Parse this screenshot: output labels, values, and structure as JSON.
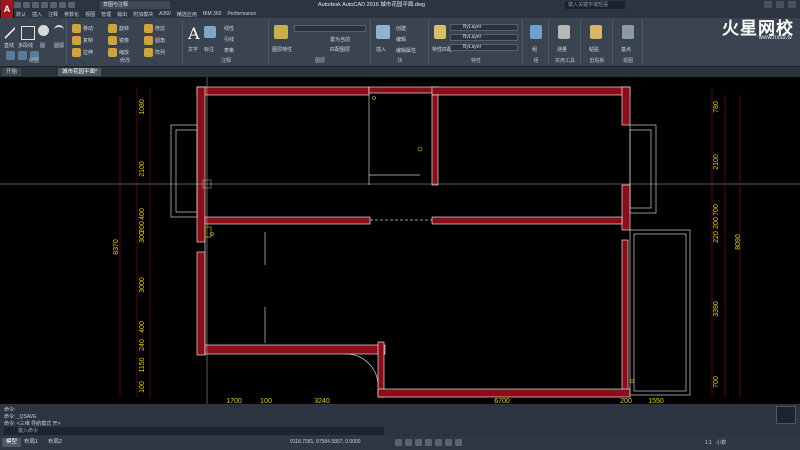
{
  "titlebar": {
    "workspace": "草图与注释",
    "title": "Autodesk AutoCAD 2016    城市花园平面.dwg",
    "search_placeholder": "键入关键字或短语"
  },
  "menubar": [
    "默认",
    "插入",
    "注释",
    "参数化",
    "视图",
    "管理",
    "输出",
    "附加模块",
    "A360",
    "精选应用",
    "BIM 360",
    "Performance"
  ],
  "ribbon": {
    "draw": {
      "line": "直线",
      "polyline": "多段线",
      "circle": "圆",
      "arc": "圆弧",
      "group_label": "绘图"
    },
    "modify": {
      "move": "移动",
      "rotate": "旋转",
      "trim": "修剪",
      "copy": "复制",
      "mirror": "镜像",
      "fillet": "圆角",
      "stretch": "拉伸",
      "scale": "缩放",
      "array": "阵列",
      "group_label": "修改"
    },
    "annotation": {
      "text": "文字",
      "dimension": "标注",
      "linear": "线性",
      "leader": "引线",
      "table": "表格",
      "group_label": "注释"
    },
    "layers": {
      "layer_props": "图层特性",
      "make_current": "置为当前",
      "match_layer": "匹配图层",
      "group_label": "图层"
    },
    "block": {
      "insert": "插入",
      "create": "创建",
      "edit": "编辑",
      "edit_attr": "编辑属性",
      "group_label": "块"
    },
    "properties": {
      "match": "特性匹配",
      "bylayer1": "ByLayer",
      "bylayer2": "ByLayer",
      "bylayer3": "ByLayer",
      "group_label": "特性"
    },
    "groups": {
      "group": "组",
      "group_label": "组"
    },
    "utilities": {
      "measure": "测量",
      "group_label": "实用工具"
    },
    "clipboard": {
      "paste": "粘贴",
      "group_label": "剪贴板"
    },
    "view": {
      "base": "基点",
      "group_label": "视图"
    }
  },
  "watermark": {
    "brand": "火星网校",
    "url": "www.hxsd.tv"
  },
  "doc_tabs": [
    "开始",
    "城市花园平面*"
  ],
  "drawing": {
    "left_dims": [
      "1080",
      "2100",
      "400",
      "200",
      "300",
      "3000",
      "400",
      "240",
      "1150",
      "100"
    ],
    "left_total": "8370",
    "right_dims": [
      "780",
      "2100",
      "700",
      "200",
      "220",
      "3390",
      "700"
    ],
    "right_total": "8090",
    "bottom_dims": [
      "1700",
      "100",
      "3240",
      "6700",
      "200",
      "1550"
    ]
  },
  "command": {
    "history": [
      "命令:",
      "命令: _QSAVE",
      "命令: <三维 导航模式 开>"
    ],
    "placeholder": "键入命令"
  },
  "layout_tabs": [
    "模型",
    "布局1",
    "布局2"
  ],
  "status": {
    "coords": "9118.7081, 97584.5857, 0.0000",
    "model": "模型",
    "scale": "1:1",
    "units": "小数"
  }
}
